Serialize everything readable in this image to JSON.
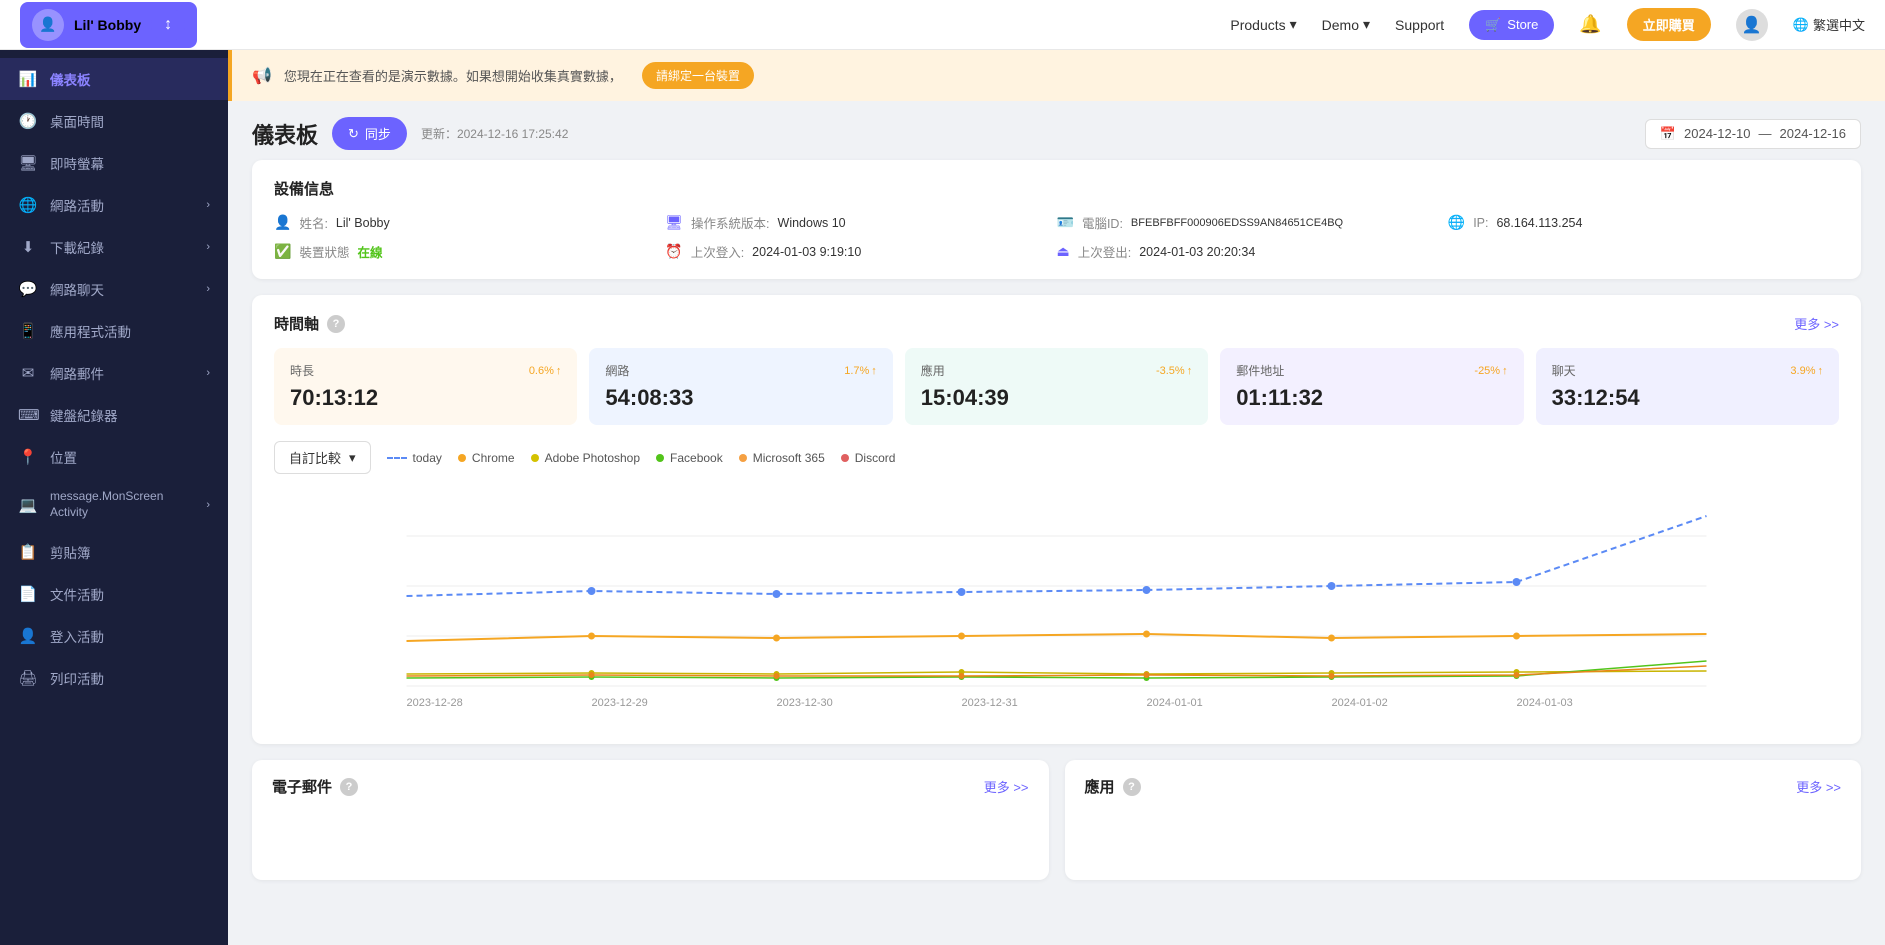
{
  "topnav": {
    "logo_name": "Lil' Bobby",
    "products_label": "Products",
    "demo_label": "Demo",
    "support_label": "Support",
    "store_label": "Store",
    "buy_label": "立即購買",
    "lang_label": "繁選中文"
  },
  "sidebar": {
    "app_name": "Lil' Bobby",
    "items": [
      {
        "id": "dashboard",
        "label": "儀表板",
        "icon": "📊",
        "active": true,
        "arrow": false
      },
      {
        "id": "screen-time",
        "label": "桌面時間",
        "icon": "🕐",
        "active": false,
        "arrow": false
      },
      {
        "id": "instant-screen",
        "label": "即時螢幕",
        "icon": "🖥",
        "active": false,
        "arrow": false
      },
      {
        "id": "network-activity",
        "label": "網路活動",
        "icon": "🌐",
        "active": false,
        "arrow": true
      },
      {
        "id": "downloads",
        "label": "下載紀錄",
        "icon": "⬇",
        "active": false,
        "arrow": true
      },
      {
        "id": "network-chat",
        "label": "網路聊天",
        "icon": "💬",
        "active": false,
        "arrow": true
      },
      {
        "id": "app-activity",
        "label": "應用程式活動",
        "icon": "📱",
        "active": false,
        "arrow": false
      },
      {
        "id": "web-mail",
        "label": "網路郵件",
        "icon": "✉",
        "active": false,
        "arrow": true
      },
      {
        "id": "keyboard-logger",
        "label": "鍵盤紀錄器",
        "icon": "⌨",
        "active": false,
        "arrow": false
      },
      {
        "id": "location",
        "label": "位置",
        "icon": "📍",
        "active": false,
        "arrow": false
      },
      {
        "id": "monscreen",
        "label": "message.MonScreen Activity",
        "icon": "💻",
        "active": false,
        "arrow": true
      },
      {
        "id": "stickers",
        "label": "剪貼簿",
        "icon": "📋",
        "active": false,
        "arrow": false
      },
      {
        "id": "file-activity",
        "label": "文件活動",
        "icon": "📄",
        "active": false,
        "arrow": false
      },
      {
        "id": "login-activity",
        "label": "登入活動",
        "icon": "👤",
        "active": false,
        "arrow": false
      },
      {
        "id": "print-activity",
        "label": "列印活動",
        "icon": "🖨",
        "active": false,
        "arrow": false
      }
    ]
  },
  "banner": {
    "text": "您現在正在查看的是演示數據。如果想開始收集真實數據，",
    "btn_label": "請綁定一台裝置"
  },
  "dashboard": {
    "title": "儀表板",
    "sync_label": "同步",
    "update_label": "更新：2024-12-16 17:25:42",
    "date_from": "2024-12-10",
    "date_to": "2024-12-16"
  },
  "device_info": {
    "card_title": "設備信息",
    "name_label": "姓名:",
    "name_value": "Lil' Bobby",
    "os_label": "操作系統版本:",
    "os_value": "Windows 10",
    "device_id_label": "電腦ID:",
    "device_id_value": "BFEBFBFF000906EDSS9AN84651CE4BQ",
    "ip_label": "IP:",
    "ip_value": "68.164.113.254",
    "status_label": "裝置狀態",
    "status_value": "在線",
    "last_login_label": "上次登入:",
    "last_login_value": "2024-01-03 9:19:10",
    "last_logout_label": "上次登出:",
    "last_logout_value": "2024-01-03 20:20:34"
  },
  "timeline": {
    "title": "時間軸",
    "more_label": "更多 >>",
    "dropdown_label": "自訂比較",
    "stats": [
      {
        "label": "時長",
        "change": "0.6%",
        "direction": "up",
        "value": "70:13:12",
        "color": "orange"
      },
      {
        "label": "網路",
        "change": "1.7%",
        "direction": "up",
        "value": "54:08:33",
        "color": "blue"
      },
      {
        "label": "應用",
        "change": "-3.5%",
        "direction": "up",
        "value": "15:04:39",
        "color": "teal"
      },
      {
        "label": "郵件地址",
        "change": "-25%",
        "direction": "up",
        "value": "01:11:32",
        "color": "purple"
      },
      {
        "label": "聊天",
        "change": "3.9%",
        "direction": "up",
        "value": "33:12:54",
        "color": "lavender"
      }
    ],
    "legend": [
      {
        "label": "today",
        "color": "#5b8af5",
        "dashed": true
      },
      {
        "label": "Chrome",
        "color": "#f5a623",
        "dashed": false
      },
      {
        "label": "Adobe Photoshop",
        "color": "#f5e642",
        "dashed": false
      },
      {
        "label": "Facebook",
        "color": "#52c41a",
        "dashed": false
      },
      {
        "label": "Microsoft 365",
        "color": "#f5a042",
        "dashed": false
      },
      {
        "label": "Discord",
        "color": "#e06060",
        "dashed": false
      }
    ],
    "x_labels": [
      "2023-12-28",
      "2023-12-29",
      "2023-12-30",
      "2023-12-31",
      "2024-01-01",
      "2024-01-02",
      "2024-01-03"
    ]
  },
  "bottom": {
    "email_title": "電子郵件",
    "email_more": "更多 >>",
    "app_title": "應用",
    "app_more": "更多 >>"
  }
}
